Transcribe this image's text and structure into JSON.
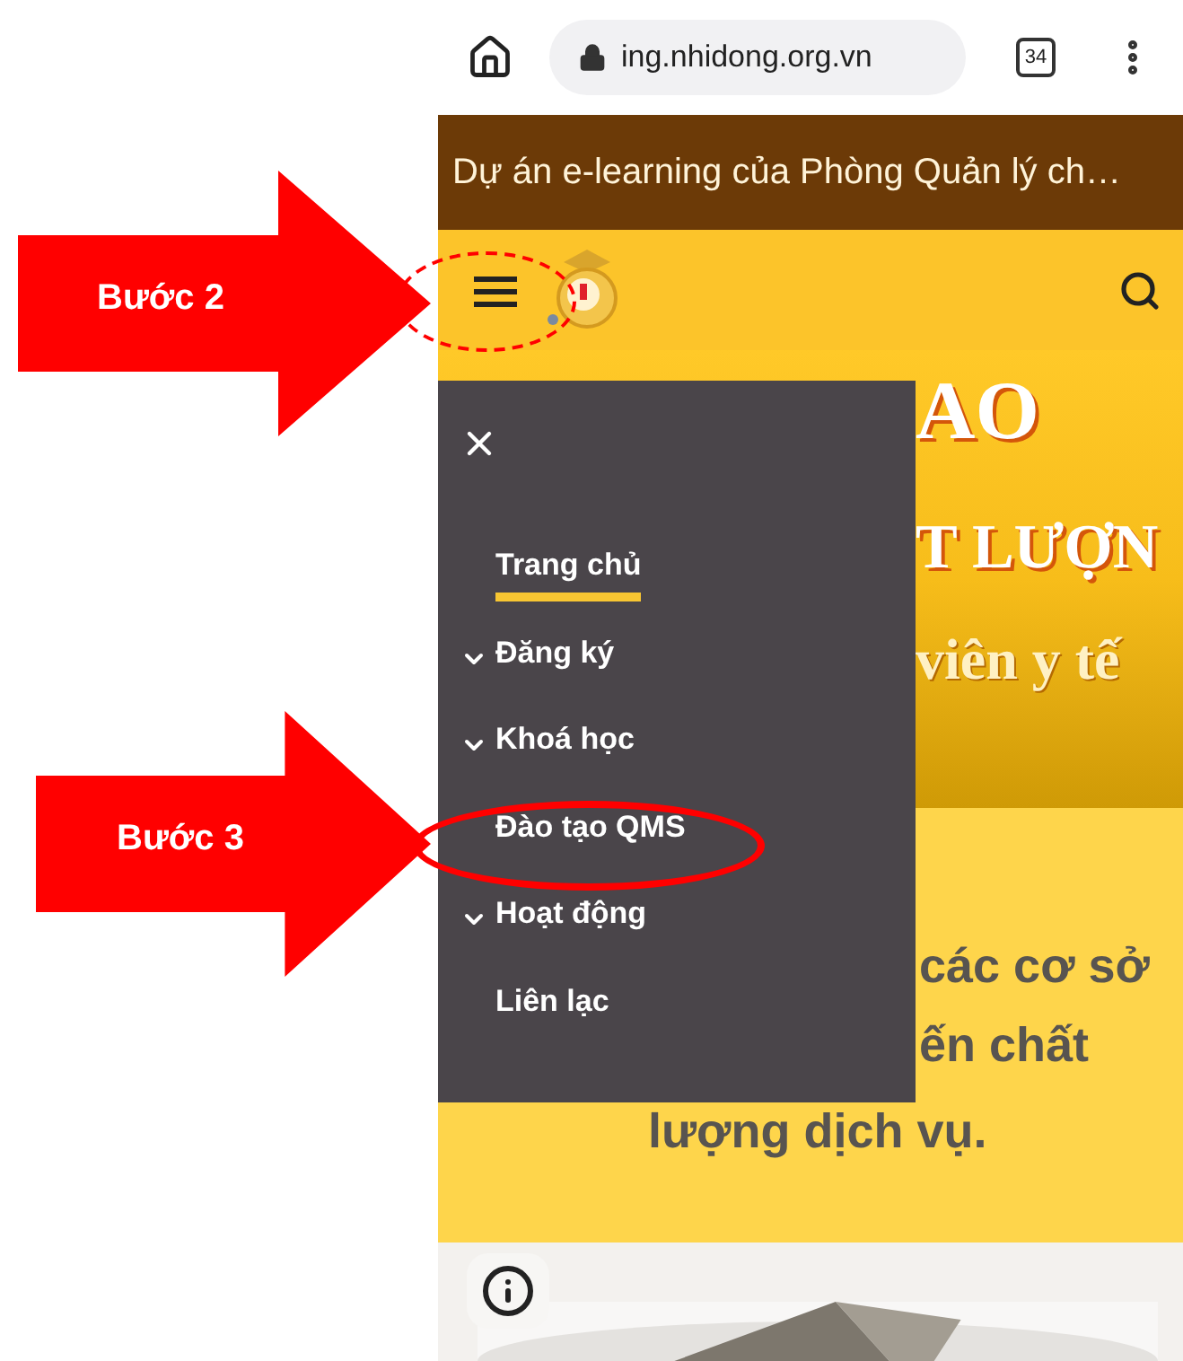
{
  "browser": {
    "url": "ing.nhidong.org.vn",
    "tab_count": "34"
  },
  "banner": {
    "text": "Dự án e-learning của Phòng Quản lý ch…"
  },
  "hero": {
    "lines": [
      "AO",
      "T LƯỢN",
      "viên y tế"
    ]
  },
  "intro": {
    "lines": [
      "các cơ sở",
      "ến chất",
      "lượng dịch vụ."
    ]
  },
  "menu": {
    "items": [
      {
        "label": "Trang chủ",
        "kind": "link",
        "selected": true
      },
      {
        "label": "Đăng ký",
        "kind": "submenu",
        "expanded": false
      },
      {
        "label": "Khoá học",
        "kind": "submenu",
        "expanded": false
      },
      {
        "label": "Đào tạo QMS",
        "kind": "link",
        "selected": false
      },
      {
        "label": "Hoạt động",
        "kind": "submenu",
        "expanded": false
      },
      {
        "label": "Liên lạc",
        "kind": "link",
        "selected": false
      }
    ]
  },
  "annotations": [
    {
      "label": "Bước 2",
      "kind": "dashed"
    },
    {
      "label": "Bước 3",
      "kind": "solid"
    }
  ]
}
